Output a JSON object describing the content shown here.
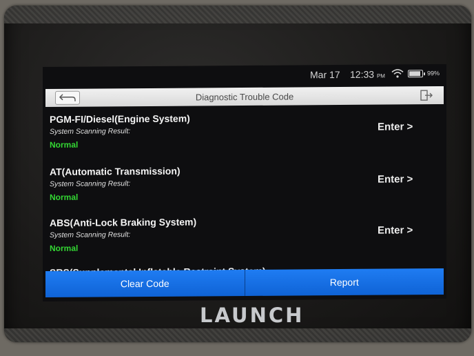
{
  "status_bar": {
    "date": "Mar 17",
    "time": "12:33",
    "ampm": "PM",
    "battery": "99%",
    "icons": [
      "wifi-icon",
      "battery-icon"
    ]
  },
  "header": {
    "title": "Diagnostic Trouble Code",
    "back_icon": "back-arrow-icon",
    "exit_icon": "exit-icon"
  },
  "systems": [
    {
      "name": "PGM-FI/Diesel(Engine System)",
      "label": "System Scanning Result:",
      "status": "Normal",
      "action": "Enter >"
    },
    {
      "name": "AT(Automatic Transmission)",
      "label": "System Scanning Result:",
      "status": "Normal",
      "action": "Enter >"
    },
    {
      "name": "ABS(Anti-Lock Braking System)",
      "label": "System Scanning Result:",
      "status": "Normal",
      "action": "Enter >"
    },
    {
      "name": "SRS(Supplemental Inflatable Restraint System)",
      "label": "",
      "status": "",
      "action": ""
    }
  ],
  "footer": {
    "clear_label": "Clear Code",
    "report_label": "Report"
  },
  "device": {
    "brand": "LAUNCH"
  },
  "colors": {
    "accent": "#1470e6",
    "status_ok": "#33d633",
    "background": "#0e0e10"
  }
}
